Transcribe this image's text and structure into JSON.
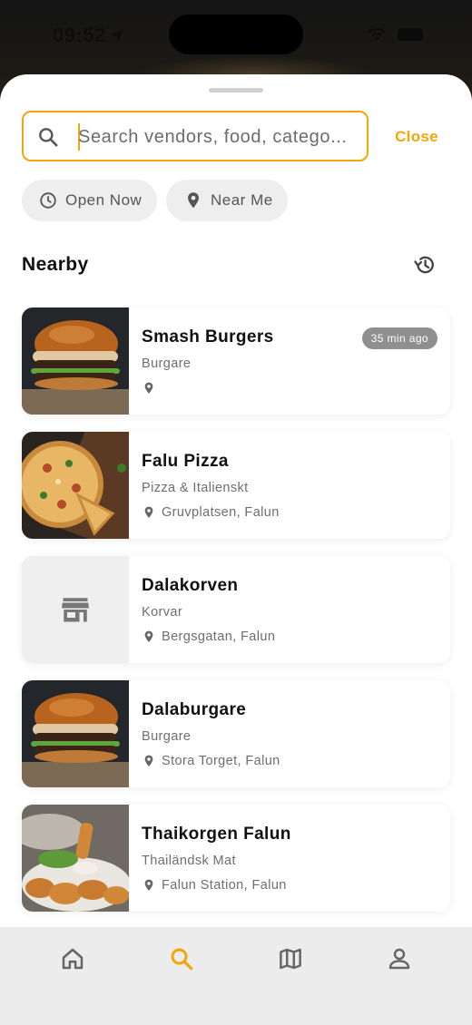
{
  "status_bar": {
    "time": "09:52"
  },
  "search": {
    "placeholder": "Search vendors, food, catego...",
    "value": "",
    "close_label": "Close"
  },
  "filters": [
    {
      "label": "Open Now",
      "icon": "clock-icon"
    },
    {
      "label": "Near Me",
      "icon": "location-pin-icon"
    }
  ],
  "section": {
    "title": "Nearby",
    "history_icon": "history-icon"
  },
  "vendors": [
    {
      "name": "Smash Burgers",
      "category": "Burgare",
      "location": "",
      "badge": "35 min ago",
      "image": "burger"
    },
    {
      "name": "Falu Pizza",
      "category": "Pizza & Italienskt",
      "location": "Gruvplatsen, Falun",
      "image": "pizza"
    },
    {
      "name": "Dalakorven",
      "category": "Korvar",
      "location": "Bergsgatan, Falun",
      "image": "store-placeholder"
    },
    {
      "name": "Dalaburgare",
      "category": "Burgare",
      "location": "Stora Torget, Falun",
      "image": "burger"
    },
    {
      "name": "Thaikorgen Falun",
      "category": "Thailändsk Mat",
      "location": "Falun Station, Falun",
      "image": "fried-chicken"
    }
  ],
  "tabbar": [
    {
      "name": "home",
      "icon": "home-icon",
      "active": false
    },
    {
      "name": "search",
      "icon": "search-icon",
      "active": true
    },
    {
      "name": "map",
      "icon": "map-icon",
      "active": false
    },
    {
      "name": "profile",
      "icon": "person-icon",
      "active": false
    }
  ],
  "colors": {
    "accent": "#F2A60C",
    "chip_bg": "#EEEEEE",
    "badge_bg": "#8F8F8F",
    "tabbar_bg": "#ECECEC"
  }
}
